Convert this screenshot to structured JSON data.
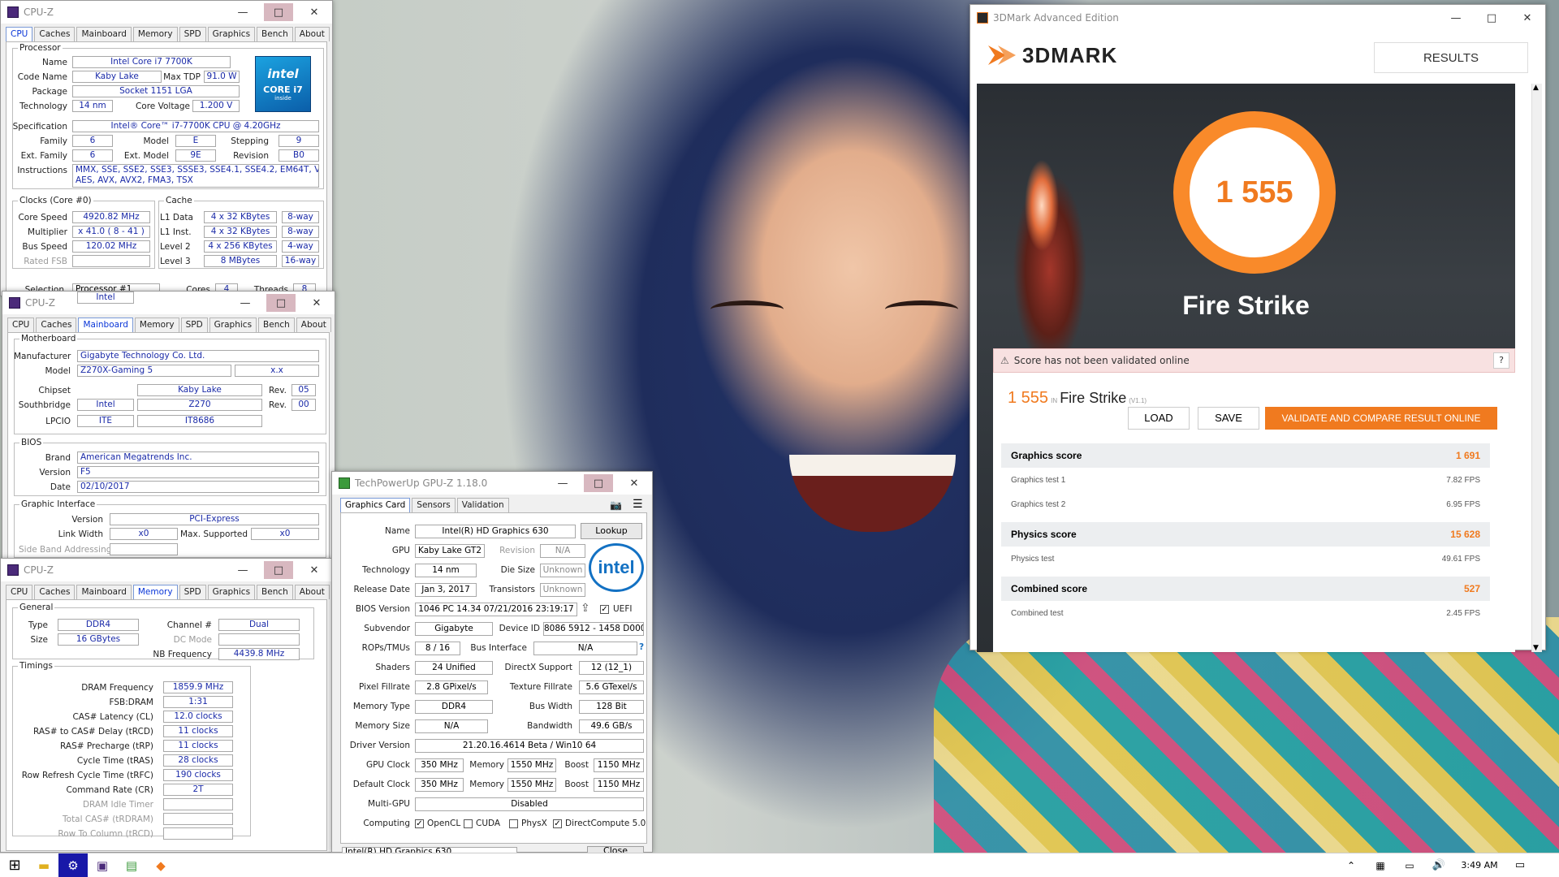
{
  "desktop": {
    "background": "photo"
  },
  "cpuz1": {
    "title": "CPU-Z",
    "tabs": [
      "CPU",
      "Caches",
      "Mainboard",
      "Memory",
      "SPD",
      "Graphics",
      "Bench",
      "About"
    ],
    "active_tab": "CPU",
    "processor_legend": "Processor",
    "name_label": "Name",
    "name": "Intel Core i7 7700K",
    "codename_label": "Code Name",
    "codename": "Kaby Lake",
    "tdp_label": "Max TDP",
    "tdp": "91.0 W",
    "package_label": "Package",
    "package": "Socket 1151 LGA",
    "tech_label": "Technology",
    "tech": "14 nm",
    "voltage_label": "Core Voltage",
    "voltage": "1.200 V",
    "spec_label": "Specification",
    "spec": "Intel® Core™ i7-7700K CPU @ 4.20GHz",
    "family_label": "Family",
    "family": "6",
    "model_label": "Model",
    "model": "E",
    "stepping_label": "Stepping",
    "stepping": "9",
    "extfam_label": "Ext. Family",
    "extfam": "6",
    "extmodel_label": "Ext. Model",
    "extmodel": "9E",
    "revision_label": "Revision",
    "revision": "B0",
    "instr_label": "Instructions",
    "instr1": "MMX, SSE, SSE2, SSE3, SSSE3, SSE4.1, SSE4.2, EM64T, VT-x,",
    "instr2": "AES, AVX, AVX2, FMA3, TSX",
    "clocks_legend": "Clocks (Core #0)",
    "cache_legend": "Cache",
    "corespeed_label": "Core Speed",
    "corespeed": "4920.82 MHz",
    "mult_label": "Multiplier",
    "mult": "x 41.0 ( 8 - 41 )",
    "bus_label": "Bus Speed",
    "bus": "120.02 MHz",
    "fsb_label": "Rated FSB",
    "fsb": "",
    "l1d_label": "L1 Data",
    "l1d": "4 x 32 KBytes",
    "l1d_w": "8-way",
    "l1i_label": "L1 Inst.",
    "l1i": "4 x 32 KBytes",
    "l1i_w": "8-way",
    "l2_label": "Level 2",
    "l2": "4 x 256 KBytes",
    "l2_w": "4-way",
    "l3_label": "Level 3",
    "l3": "8 MBytes",
    "l3_w": "16-way",
    "sel_label": "Selection",
    "sel": "Processor #1",
    "cores_label": "Cores",
    "cores": "4",
    "threads_label": "Threads",
    "threads": "8",
    "badge": {
      "brand": "intel",
      "line1": "CORE i7",
      "line2": "inside"
    }
  },
  "cpuz2": {
    "title": "CPU-Z",
    "tabs": [
      "CPU",
      "Caches",
      "Mainboard",
      "Memory",
      "SPD",
      "Graphics",
      "Bench",
      "About"
    ],
    "active_tab": "Mainboard",
    "mb_legend": "Motherboard",
    "manuf_label": "Manufacturer",
    "manuf": "Gigabyte Technology Co. Ltd.",
    "model_label": "Model",
    "model": "Z270X-Gaming 5",
    "model_rev": "x.x",
    "chipset_label": "Chipset",
    "chipset_v": "Intel",
    "chipset_n": "Kaby Lake",
    "rev_label": "Rev.",
    "chipset_rev": "05",
    "sb_label": "Southbridge",
    "sb_v": "Intel",
    "sb_n": "Z270",
    "sb_rev": "00",
    "lpcio_label": "LPCIO",
    "lpcio_v": "ITE",
    "lpcio_n": "IT8686",
    "bios_legend": "BIOS",
    "brand_label": "Brand",
    "brand": "American Megatrends Inc.",
    "version_label": "Version",
    "version": "F5",
    "date_label": "Date",
    "date": "02/10/2017",
    "gi_legend": "Graphic Interface",
    "giver_label": "Version",
    "giver": "PCI-Express",
    "lw_label": "Link Width",
    "lw": "x0",
    "ms_label": "Max. Supported",
    "ms": "x0",
    "sba_label": "Side Band Addressing"
  },
  "cpuz3": {
    "title": "CPU-Z",
    "tabs": [
      "CPU",
      "Caches",
      "Mainboard",
      "Memory",
      "SPD",
      "Graphics",
      "Bench",
      "About"
    ],
    "active_tab": "Memory",
    "gen_legend": "General",
    "type_label": "Type",
    "type": "DDR4",
    "channel_label": "Channel #",
    "channel": "Dual",
    "size_label": "Size",
    "size": "16 GBytes",
    "dc_label": "DC Mode",
    "nb_label": "NB Frequency",
    "nb": "4439.8 MHz",
    "tim_legend": "Timings",
    "timings": [
      {
        "label": "DRAM Frequency",
        "value": "1859.9 MHz"
      },
      {
        "label": "FSB:DRAM",
        "value": "1:31"
      },
      {
        "label": "CAS# Latency (CL)",
        "value": "12.0 clocks"
      },
      {
        "label": "RAS# to CAS# Delay (tRCD)",
        "value": "11 clocks"
      },
      {
        "label": "RAS# Precharge (tRP)",
        "value": "11 clocks"
      },
      {
        "label": "Cycle Time (tRAS)",
        "value": "28 clocks"
      },
      {
        "label": "Row Refresh Cycle Time (tRFC)",
        "value": "190 clocks"
      },
      {
        "label": "Command Rate (CR)",
        "value": "2T"
      },
      {
        "label": "DRAM Idle Timer",
        "value": ""
      },
      {
        "label": "Total CAS# (tRDRAM)",
        "value": ""
      },
      {
        "label": "Row To Column (tRCD)",
        "value": ""
      }
    ]
  },
  "gpuz": {
    "title": "TechPowerUp GPU-Z 1.18.0",
    "tabs": [
      "Graphics Card",
      "Sensors",
      "Validation"
    ],
    "name_label": "Name",
    "name": "Intel(R) HD Graphics 630",
    "lookup": "Lookup",
    "gpu_label": "GPU",
    "gpu": "Kaby Lake GT2",
    "revision_label": "Revision",
    "revision": "N/A",
    "tech_label": "Technology",
    "tech": "14 nm",
    "die_label": "Die Size",
    "die": "Unknown",
    "rel_label": "Release Date",
    "rel": "Jan 3, 2017",
    "trans_label": "Transistors",
    "trans": "Unknown",
    "bios_label": "BIOS Version",
    "bios": "1046 PC 14.34 07/21/2016 23:19:17",
    "uefi": "UEFI",
    "sub_label": "Subvendor",
    "sub": "Gigabyte",
    "devid_label": "Device ID",
    "devid": "8086 5912 - 1458 D000",
    "rops_label": "ROPs/TMUs",
    "rops": "8 / 16",
    "busif_label": "Bus Interface",
    "busif": "N/A",
    "q": "?",
    "shaders_label": "Shaders",
    "shaders": "24 Unified",
    "dx_label": "DirectX Support",
    "dx": "12 (12_1)",
    "pf_label": "Pixel Fillrate",
    "pf": "2.8 GPixel/s",
    "tf_label": "Texture Fillrate",
    "tf": "5.6 GTexel/s",
    "mt_label": "Memory Type",
    "mt": "DDR4",
    "bw_label": "Bus Width",
    "bw": "128 Bit",
    "ms_label": "Memory Size",
    "ms": "N/A",
    "band_label": "Bandwidth",
    "band": "49.6 GB/s",
    "drv_label": "Driver Version",
    "drv": "21.20.16.4614 Beta / Win10 64",
    "gclk_label": "GPU Clock",
    "gclk": "350 MHz",
    "mem_label": "Memory",
    "gmem": "1550 MHz",
    "boost_label": "Boost",
    "gboost": "1150 MHz",
    "dclk_label": "Default Clock",
    "dclk": "350 MHz",
    "dmem": "1550 MHz",
    "dboost": "1150 MHz",
    "multi_label": "Multi-GPU",
    "multi": "Disabled",
    "comp_label": "Computing",
    "opencl": "OpenCL",
    "cuda": "CUDA",
    "physx": "PhysX",
    "dc5": "DirectCompute 5.0",
    "select": "Intel(R) HD Graphics 630",
    "close": "Close",
    "intel_logo": "intel"
  },
  "tdmark": {
    "title": "3DMark Advanced Edition",
    "logo": "3DMARK",
    "results": "RESULTS",
    "score": "1 555",
    "test": "Fire Strike",
    "warning": "Score has not been validated online",
    "help": "?",
    "score_line_score": "1 555",
    "score_line_in": "IN",
    "score_line_test": "Fire Strike",
    "score_line_ver": "(V1.1)",
    "load": "LOAD",
    "save": "SAVE",
    "validate": "VALIDATE AND COMPARE RESULT ONLINE",
    "rows": [
      {
        "label": "Graphics score",
        "value": "1 691",
        "kind": "main"
      },
      {
        "label": "Graphics test 1",
        "value": "7.82 FPS",
        "kind": "sub"
      },
      {
        "label": "Graphics test 2",
        "value": "6.95 FPS",
        "kind": "sub"
      },
      {
        "label": "Physics score",
        "value": "15 628",
        "kind": "main"
      },
      {
        "label": "Physics test",
        "value": "49.61 FPS",
        "kind": "sub"
      },
      {
        "label": "Combined score",
        "value": "527",
        "kind": "main"
      },
      {
        "label": "Combined test",
        "value": "2.45 FPS",
        "kind": "sub"
      }
    ],
    "accent": "#f07a1f"
  },
  "taskbar": {
    "time": "3:49 AM",
    "icons": [
      "windows-start-icon",
      "file-explorer-icon",
      "cpuz-icon",
      "cpuz-icon",
      "gpuz-icon",
      "3dmark-icon"
    ]
  }
}
